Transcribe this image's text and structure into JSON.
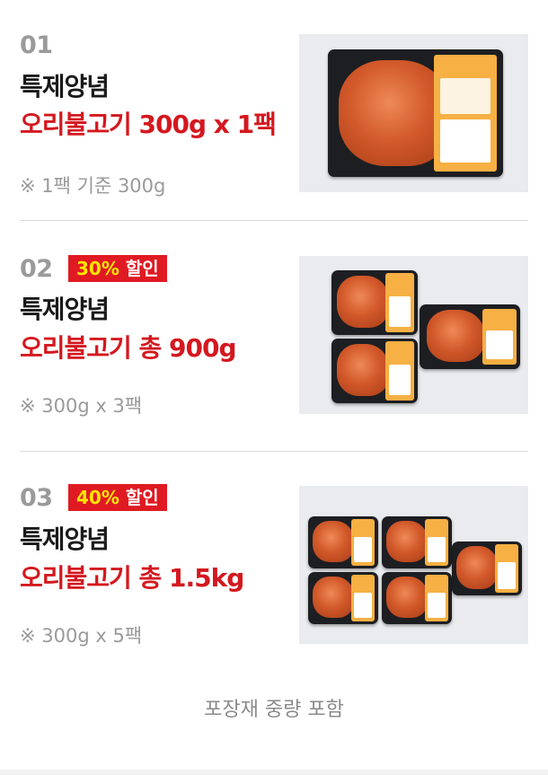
{
  "products": [
    {
      "number": "01",
      "title": "특제양념",
      "subtitle": "오리불고기 300g x 1팩",
      "note": "※ 1팩 기준 300g"
    },
    {
      "number": "02",
      "badge_pct": "30%",
      "badge_text": "할인",
      "title": "특제양념",
      "subtitle": "오리불고기 총 900g",
      "note": "※ 300g x 3팩"
    },
    {
      "number": "03",
      "badge_pct": "40%",
      "badge_text": "할인",
      "title": "특제양념",
      "subtitle": "오리불고기 총 1.5kg",
      "note": "※ 300g x 5팩"
    }
  ],
  "footer": "포장재 중량 포함",
  "colors": {
    "accent_red": "#d4181f",
    "badge_red": "#e01a22",
    "badge_pct_yellow": "#ffe600",
    "muted_gray": "#9a9a9a"
  }
}
